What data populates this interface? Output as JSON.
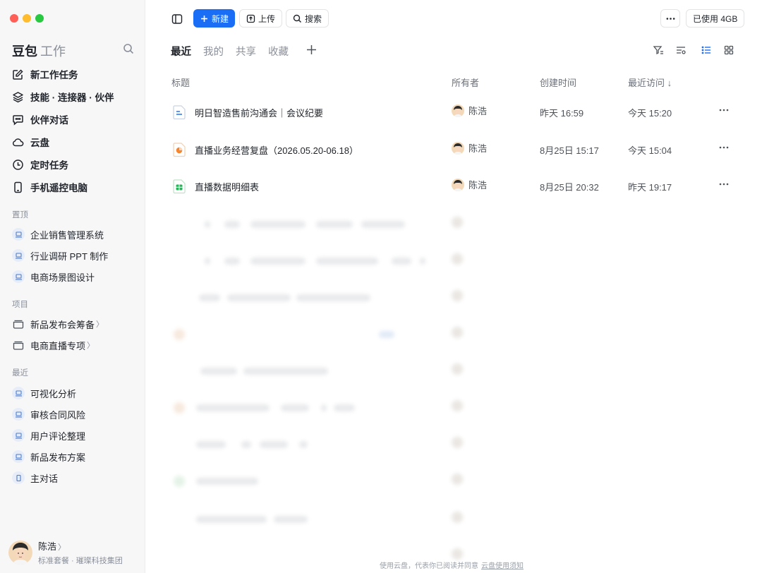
{
  "sidebar": {
    "brand": {
      "name": "豆包",
      "sub": "工作"
    },
    "nav": [
      {
        "label": "新工作任务",
        "icon": "edit-icon"
      },
      {
        "label": "技能 · 连接器 · 伙伴",
        "icon": "layers-icon"
      },
      {
        "label": "伙伴对话",
        "icon": "chat-icon"
      },
      {
        "label": "云盘",
        "icon": "cloud-icon"
      },
      {
        "label": "定时任务",
        "icon": "clock-icon"
      },
      {
        "label": "手机遥控电脑",
        "icon": "phone-icon"
      }
    ],
    "pinned_title": "置顶",
    "pinned": [
      "企业销售管理系统",
      "行业调研 PPT 制作",
      "电商场景图设计"
    ],
    "projects_title": "项目",
    "projects": [
      "新品发布会筹备",
      "电商直播专项"
    ],
    "recent_title": "最近",
    "recent": [
      "可视化分析",
      "审核合同风险",
      "用户评论整理",
      "新品发布方案",
      "主对话"
    ],
    "user": {
      "name": "陈浩",
      "plan": "标准套餐 · 璀璨科技集团"
    }
  },
  "toolbar": {
    "new_label": "新建",
    "upload_label": "上传",
    "search_label": "搜索",
    "usage_label": "已使用 4GB"
  },
  "tabs": [
    "最近",
    "我的",
    "共享",
    "收藏"
  ],
  "table": {
    "headers": {
      "title": "标题",
      "owner": "所有者",
      "created": "创建时间",
      "visited": "最近访问 ↓"
    },
    "rows": [
      {
        "title": "明日智造售前沟通会｜会议纪要",
        "owner": "陈浩",
        "created": "昨天 16:59",
        "visited": "今天 15:20",
        "icon": "doc-icon"
      },
      {
        "title": "直播业务经营复盘（2026.05.20-06.18）",
        "owner": "陈浩",
        "created": "8月25日 15:17",
        "visited": "今天 15:04",
        "icon": "slides-icon"
      },
      {
        "title": "直播数据明细表",
        "owner": "陈浩",
        "created": "8月25日 20:32",
        "visited": "昨天 19:17",
        "icon": "sheet-icon"
      }
    ]
  },
  "footer": {
    "text": "使用云盘，代表你已阅读并同意",
    "link": "云盘使用须知"
  },
  "colors": {
    "accent": "#1a6ef5",
    "sidebar_bg": "#f7f7f8"
  }
}
